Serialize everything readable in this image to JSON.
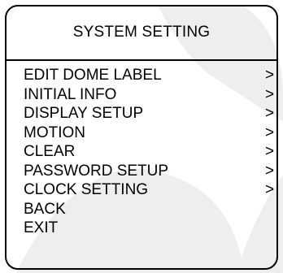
{
  "menu": {
    "title": "SYSTEM SETTING",
    "items": [
      {
        "label": "EDIT DOME LABEL",
        "arrow": ">"
      },
      {
        "label": "INITIAL INFO",
        "arrow": ">"
      },
      {
        "label": "DISPLAY SETUP",
        "arrow": ">"
      },
      {
        "label": "MOTION",
        "arrow": ">"
      },
      {
        "label": "CLEAR",
        "arrow": ">"
      },
      {
        "label": "PASSWORD SETUP",
        "arrow": ">"
      },
      {
        "label": "CLOCK SETTING",
        "arrow": ">"
      },
      {
        "label": "BACK",
        "arrow": ""
      },
      {
        "label": "EXIT",
        "arrow": ""
      }
    ]
  },
  "colors": {
    "text": "#000000",
    "border": "#000000",
    "background": "#ffffff",
    "watermark": "#eeeeee"
  }
}
